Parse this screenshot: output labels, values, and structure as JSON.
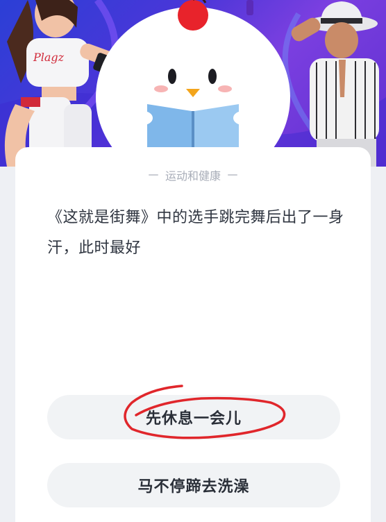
{
  "quiz": {
    "category": "运动和健康",
    "question": "《这就是街舞》中的选手跳完舞后出了一身汗，此时最好",
    "options": [
      {
        "label": "先休息一会儿",
        "circled": true
      },
      {
        "label": "马不停蹄去洗澡",
        "circled": false
      }
    ]
  },
  "banner": {
    "mascot": "chick-reading-book",
    "left_figure": "dancer-girl-white-outfit",
    "right_figure": "dancer-boy-white-hat"
  },
  "colors": {
    "banner_gradient_start": "#2b3fd6",
    "banner_gradient_end": "#7b3fe0",
    "card_background": "#ffffff",
    "option_background": "#f1f3f5",
    "annotation_red": "#e0262b"
  }
}
